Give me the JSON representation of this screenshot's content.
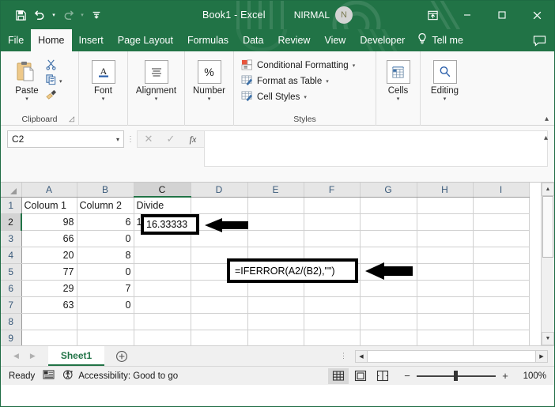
{
  "titlebar": {
    "quick_access": [
      {
        "name": "save-icon",
        "label": "Save"
      },
      {
        "name": "undo-icon",
        "label": "Undo"
      },
      {
        "name": "redo-icon",
        "label": "Redo"
      },
      {
        "name": "customize-quick-access-icon",
        "label": "Customize Quick Access Toolbar"
      }
    ],
    "document_title": "Book1  -  Excel",
    "account_name": "NIRMAL",
    "avatar_initial": "N",
    "window_buttons": {
      "ribbon_display": "Ribbon Display Options",
      "minimize": "—",
      "maximize": "□",
      "close": "✕"
    },
    "accent_color": "#217346"
  },
  "tabs": {
    "items": [
      {
        "label": "File",
        "active": false
      },
      {
        "label": "Home",
        "active": true
      },
      {
        "label": "Insert",
        "active": false
      },
      {
        "label": "Page Layout",
        "active": false
      },
      {
        "label": "Formulas",
        "active": false
      },
      {
        "label": "Data",
        "active": false
      },
      {
        "label": "Review",
        "active": false
      },
      {
        "label": "View",
        "active": false
      },
      {
        "label": "Developer",
        "active": false
      }
    ],
    "tell_me": "Tell me",
    "comments": "Comments"
  },
  "ribbon": {
    "clipboard": {
      "paste_label": "Paste",
      "group_label": "Clipboard",
      "cut_label": "Cut",
      "copy_label": "Copy",
      "format_painter_label": "Format Painter"
    },
    "font": {
      "label": "Font"
    },
    "alignment": {
      "label": "Alignment"
    },
    "number": {
      "label": "Number",
      "symbol": "%"
    },
    "styles": {
      "group_label": "Styles",
      "items": [
        {
          "label": "Conditional Formatting"
        },
        {
          "label": "Format as Table"
        },
        {
          "label": "Cell Styles"
        }
      ]
    },
    "cells": {
      "label": "Cells"
    },
    "editing": {
      "label": "Editing"
    },
    "collapse_label": "Collapse the Ribbon"
  },
  "formula_bar": {
    "name_box_value": "C2",
    "cancel_label": "✕",
    "enter_label": "✓",
    "insert_function_label": "fx",
    "formula": "=IFERROR(A2/(B2),\"\")",
    "expand_label": "Expand Formula Bar"
  },
  "annotations": [
    {
      "name": "formula-highlight",
      "text": "=IFERROR(A2/(B2),\"\")"
    },
    {
      "name": "formula-arrow"
    },
    {
      "name": "cell-highlight",
      "text": "16.33333"
    },
    {
      "name": "cell-arrow"
    }
  ],
  "grid": {
    "columns": [
      "A",
      "B",
      "C",
      "D",
      "E",
      "F",
      "G",
      "H",
      "I"
    ],
    "selected_column": "C",
    "selected_row": "2",
    "rows": [
      {
        "header": "1",
        "cells": [
          {
            "v": "Coloum 1",
            "align": "txt"
          },
          {
            "v": "Column 2",
            "align": "txt"
          },
          {
            "v": "Divide",
            "align": "txt"
          },
          {
            "v": "",
            "align": "txt"
          },
          {
            "v": "",
            "align": "txt"
          },
          {
            "v": "",
            "align": "txt"
          },
          {
            "v": "",
            "align": "txt"
          },
          {
            "v": "",
            "align": "txt"
          },
          {
            "v": "",
            "align": "txt"
          }
        ]
      },
      {
        "header": "2",
        "cells": [
          {
            "v": "98",
            "align": "num"
          },
          {
            "v": "6",
            "align": "num"
          },
          {
            "v": "16.33333",
            "align": "txt"
          },
          {
            "v": "",
            "align": "txt"
          },
          {
            "v": "",
            "align": "txt"
          },
          {
            "v": "",
            "align": "txt"
          },
          {
            "v": "",
            "align": "txt"
          },
          {
            "v": "",
            "align": "txt"
          },
          {
            "v": "",
            "align": "txt"
          }
        ]
      },
      {
        "header": "3",
        "cells": [
          {
            "v": "66",
            "align": "num"
          },
          {
            "v": "0",
            "align": "num"
          },
          {
            "v": "",
            "align": "txt"
          },
          {
            "v": "",
            "align": "txt"
          },
          {
            "v": "",
            "align": "txt"
          },
          {
            "v": "",
            "align": "txt"
          },
          {
            "v": "",
            "align": "txt"
          },
          {
            "v": "",
            "align": "txt"
          },
          {
            "v": "",
            "align": "txt"
          }
        ]
      },
      {
        "header": "4",
        "cells": [
          {
            "v": "20",
            "align": "num"
          },
          {
            "v": "8",
            "align": "num"
          },
          {
            "v": "",
            "align": "txt"
          },
          {
            "v": "",
            "align": "txt"
          },
          {
            "v": "",
            "align": "txt"
          },
          {
            "v": "",
            "align": "txt"
          },
          {
            "v": "",
            "align": "txt"
          },
          {
            "v": "",
            "align": "txt"
          },
          {
            "v": "",
            "align": "txt"
          }
        ]
      },
      {
        "header": "5",
        "cells": [
          {
            "v": "77",
            "align": "num"
          },
          {
            "v": "0",
            "align": "num"
          },
          {
            "v": "",
            "align": "txt"
          },
          {
            "v": "",
            "align": "txt"
          },
          {
            "v": "",
            "align": "txt"
          },
          {
            "v": "",
            "align": "txt"
          },
          {
            "v": "",
            "align": "txt"
          },
          {
            "v": "",
            "align": "txt"
          },
          {
            "v": "",
            "align": "txt"
          }
        ]
      },
      {
        "header": "6",
        "cells": [
          {
            "v": "29",
            "align": "num"
          },
          {
            "v": "7",
            "align": "num"
          },
          {
            "v": "",
            "align": "txt"
          },
          {
            "v": "",
            "align": "txt"
          },
          {
            "v": "",
            "align": "txt"
          },
          {
            "v": "",
            "align": "txt"
          },
          {
            "v": "",
            "align": "txt"
          },
          {
            "v": "",
            "align": "txt"
          },
          {
            "v": "",
            "align": "txt"
          }
        ]
      },
      {
        "header": "7",
        "cells": [
          {
            "v": "63",
            "align": "num"
          },
          {
            "v": "0",
            "align": "num"
          },
          {
            "v": "",
            "align": "txt"
          },
          {
            "v": "",
            "align": "txt"
          },
          {
            "v": "",
            "align": "txt"
          },
          {
            "v": "",
            "align": "txt"
          },
          {
            "v": "",
            "align": "txt"
          },
          {
            "v": "",
            "align": "txt"
          },
          {
            "v": "",
            "align": "txt"
          }
        ]
      },
      {
        "header": "8",
        "cells": [
          {
            "v": "",
            "align": "txt"
          },
          {
            "v": "",
            "align": "txt"
          },
          {
            "v": "",
            "align": "txt"
          },
          {
            "v": "",
            "align": "txt"
          },
          {
            "v": "",
            "align": "txt"
          },
          {
            "v": "",
            "align": "txt"
          },
          {
            "v": "",
            "align": "txt"
          },
          {
            "v": "",
            "align": "txt"
          },
          {
            "v": "",
            "align": "txt"
          }
        ]
      },
      {
        "header": "9",
        "cells": [
          {
            "v": "",
            "align": "txt"
          },
          {
            "v": "",
            "align": "txt"
          },
          {
            "v": "",
            "align": "txt"
          },
          {
            "v": "",
            "align": "txt"
          },
          {
            "v": "",
            "align": "txt"
          },
          {
            "v": "",
            "align": "txt"
          },
          {
            "v": "",
            "align": "txt"
          },
          {
            "v": "",
            "align": "txt"
          },
          {
            "v": "",
            "align": "txt"
          }
        ]
      }
    ]
  },
  "sheet_tabs": {
    "prev_label": "◀",
    "next_label": "▶",
    "sheets": [
      {
        "label": "Sheet1",
        "active": true
      }
    ],
    "add_label": "+"
  },
  "status_bar": {
    "state": "Ready",
    "macro_label": "Record Macro",
    "accessibility": "Accessibility: Good to go",
    "views": [
      {
        "name": "normal-view-icon",
        "label": "Normal",
        "active": true
      },
      {
        "name": "page-layout-view-icon",
        "label": "Page Layout",
        "active": false
      },
      {
        "name": "page-break-view-icon",
        "label": "Page Break Preview",
        "active": false
      }
    ],
    "zoom_out": "−",
    "zoom_in": "+",
    "zoom_level": "100%"
  }
}
